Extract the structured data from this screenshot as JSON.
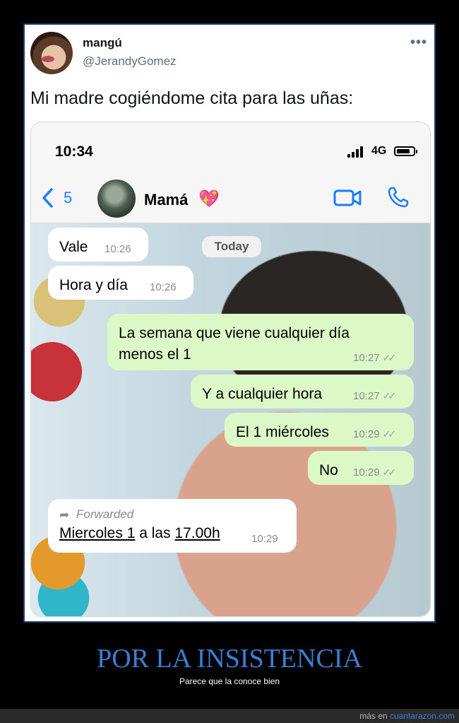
{
  "tweet": {
    "author_name": "mangú",
    "author_handle": "@JerandyGomez",
    "text": "Mi madre cogiéndome cita para las uñas:"
  },
  "phone": {
    "status_time": "10:34",
    "network": "4G",
    "back_count": "5",
    "contact_name": "Mamá",
    "contact_emoji": "💖",
    "today_label": "Today"
  },
  "messages": [
    {
      "dir": "in",
      "text": "Vale",
      "time": "10:26"
    },
    {
      "dir": "in",
      "text": "Hora y día",
      "time": "10:26"
    },
    {
      "dir": "out",
      "line1": "La semana que viene cualquier día",
      "line2": "menos el 1",
      "time": "10:27"
    },
    {
      "dir": "out",
      "text": "Y a cualquier hora",
      "time": "10:27"
    },
    {
      "dir": "out",
      "text": "El 1 miércoles",
      "time": "10:29"
    },
    {
      "dir": "out",
      "text": "No",
      "time": "10:29"
    },
    {
      "dir": "in",
      "forwarded_label": "Forwarded",
      "parts": [
        "Miercoles 1",
        " a las ",
        "17.00h"
      ],
      "time": "10:29"
    }
  ],
  "caption": {
    "title": "POR LA INSISTENCIA",
    "subtitle": "Parece que la conoce bien"
  },
  "footer": {
    "prefix": "más en ",
    "site": "cuantarazon.com"
  },
  "colors": {
    "outgoing_bubble": "#dcf8c6",
    "incoming_bubble": "#ffffff",
    "ios_blue": "#1b7ef5",
    "caption_title": "#3a7fd5"
  }
}
